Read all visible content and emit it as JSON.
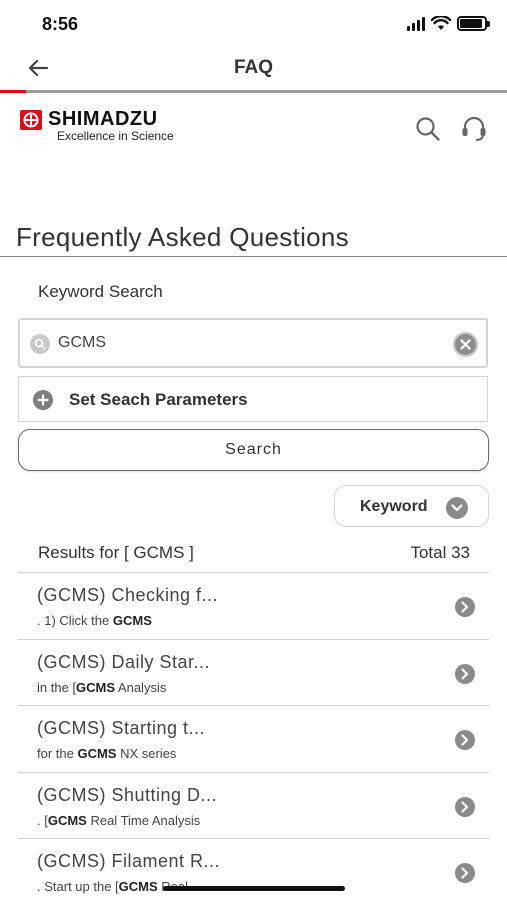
{
  "status_bar": {
    "time": "8:56",
    "battery_level": 0.9
  },
  "nav": {
    "title": "FAQ",
    "back_icon": "back-arrow-icon"
  },
  "brand": {
    "name": "SHIMADZU",
    "tagline": "Excellence in Science"
  },
  "header_icons": [
    "search-icon",
    "headset-icon"
  ],
  "page": {
    "title": "Frequently Asked Questions"
  },
  "search": {
    "label": "Keyword Search",
    "value": "GCMS",
    "clear_icon": "clear-icon"
  },
  "parameters": {
    "label": "Set Seach Parameters",
    "icon": "plus-circle-icon"
  },
  "search_button": {
    "label": "Search"
  },
  "sort": {
    "label": "Keyword",
    "icon": "chevron-down-icon"
  },
  "results": {
    "summary": "Results for [ GCMS ]",
    "total": "Total 33",
    "items": [
      {
        "title": "(GCMS) Checking f...",
        "snippet_pre": ". 1) Click the ",
        "snippet_bold": "GCMS",
        "snippet_post": ""
      },
      {
        "title": "(GCMS) Daily Star...",
        "snippet_pre": "in the [",
        "snippet_bold": "GCMS",
        "snippet_post": " Analysis"
      },
      {
        "title": "(GCMS) Starting t...",
        "snippet_pre": "for the ",
        "snippet_bold": "GCMS",
        "snippet_post": " NX series"
      },
      {
        "title": "(GCMS) Shutting D...",
        "snippet_pre": ". [",
        "snippet_bold": "GCMS",
        "snippet_post": " Real Time Analysis"
      },
      {
        "title": "(GCMS) Filament R...",
        "snippet_pre": ". Start up the [",
        "snippet_bold": "GCMS",
        "snippet_post": " Real"
      }
    ]
  },
  "colors": {
    "brand_red": "#d8101d",
    "accent_red": "#e0001a",
    "icon_grey": "#8a8a8a"
  }
}
